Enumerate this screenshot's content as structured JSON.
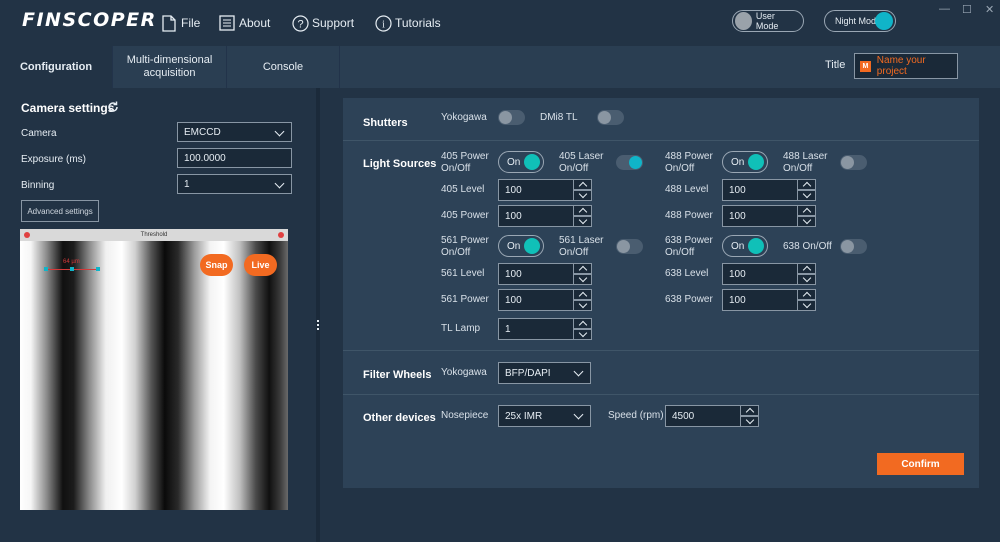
{
  "app": {
    "logo": "FINSCOPER"
  },
  "menu": {
    "file": "File",
    "about": "About",
    "support": "Support",
    "tutorials": "Tutorials"
  },
  "modes": {
    "user": "User Mode",
    "night": "Night Mode"
  },
  "window": {
    "minimize": "—",
    "maximize": "☐",
    "close": "✕"
  },
  "tabs": [
    {
      "label": "Configuration"
    },
    {
      "label": "Multi-dimensional acquisition"
    },
    {
      "label": "Console"
    }
  ],
  "project": {
    "title_label": "Title",
    "name_placeholder": "Name your project",
    "icon_letter": "M"
  },
  "camera": {
    "heading": "Camera settings",
    "camera_label": "Camera",
    "camera_value": "EMCCD",
    "exposure_label": "Exposure (ms)",
    "exposure_value": "100.0000",
    "binning_label": "Binning",
    "binning_value": "1",
    "advanced_label": "Advanced settings",
    "view_title": "Threshold",
    "scale_label": "64 µm",
    "snap_label": "Snap",
    "live_label": "Live"
  },
  "shutters": {
    "title": "Shutters",
    "yokogawa_label": "Yokogawa",
    "yokogawa_on": false,
    "dmi8_label": "DMi8 TL",
    "dmi8_on": false
  },
  "light_sources": {
    "title": "Light Sources",
    "on_label": "On",
    "p405_label": "405 Power On/Off",
    "laser405_label": "405 Laser On/Off",
    "laser405_on": true,
    "level405_label": "405 Level",
    "level405_value": "100",
    "power405_label": "405 Power",
    "power405_value": "100",
    "p488_label": "488 Power On/Off",
    "laser488_label": "488 Laser On/Off",
    "laser488_on": false,
    "level488_label": "488 Level",
    "level488_value": "100",
    "power488_label": "488 Power",
    "power488_value": "100",
    "p561_label": "561 Power On/Off",
    "laser561_label": "561 Laser On/Off",
    "laser561_on": false,
    "level561_label": "561 Level",
    "level561_value": "100",
    "power561_label": "561 Power",
    "power561_value": "100",
    "p638_label": "638 Power On/Off",
    "onoff638_label": "638 On/Off",
    "onoff638_on": false,
    "level638_label": "638 Level",
    "level638_value": "100",
    "power638_label": "638 Power",
    "power638_value": "100",
    "tl_lamp_label": "TL Lamp",
    "tl_lamp_value": "1"
  },
  "filter_wheels": {
    "title": "Filter Wheels",
    "yokogawa_label": "Yokogawa",
    "yokogawa_value": "BFP/DAPI"
  },
  "other_devices": {
    "title": "Other devices",
    "nosepiece_label": "Nosepiece",
    "nosepiece_value": "25x IMR",
    "speed_label": "Speed (rpm)",
    "speed_value": "4500"
  },
  "confirm_label": "Confirm",
  "colors": {
    "accent": "#f26a21",
    "teal": "#10b4c8",
    "background": "#223345",
    "card": "#2d4257"
  }
}
